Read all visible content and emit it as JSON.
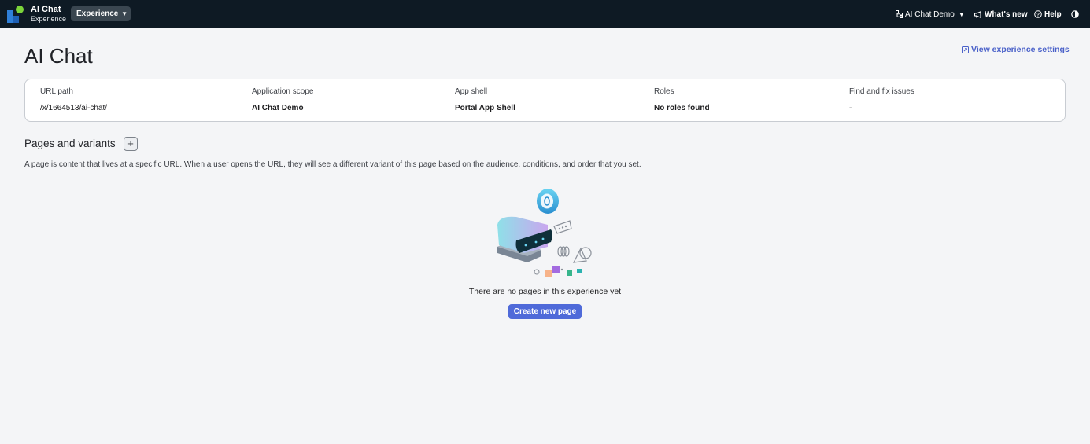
{
  "topbar": {
    "app_title": "AI Chat",
    "app_subtitle": "Experience",
    "experience_button": "Experience",
    "scope_selector": "AI Chat Demo",
    "whats_new": "What's new",
    "help": "Help"
  },
  "header": {
    "title": "AI Chat",
    "settings_link": "View experience settings"
  },
  "info": {
    "columns": [
      {
        "label": "URL path",
        "value": "/x/1664513/ai-chat/"
      },
      {
        "label": "Application scope",
        "value": "AI Chat Demo"
      },
      {
        "label": "App shell",
        "value": "Portal App Shell"
      },
      {
        "label": "Roles",
        "value": "No roles found"
      },
      {
        "label": "Find and fix issues",
        "value": "-"
      }
    ]
  },
  "pages": {
    "title": "Pages and variants",
    "add_label": "+",
    "description": "A page is content that lives at a specific URL. When a user opens the URL, they will see a different variant of this page based on the audience, conditions, and order that you set.",
    "empty_text": "There are no pages in this experience yet",
    "create_button": "Create new page"
  },
  "colors": {
    "topbar": "#0e1a24",
    "accent": "#4f6ad9",
    "link": "#4a61c9"
  }
}
